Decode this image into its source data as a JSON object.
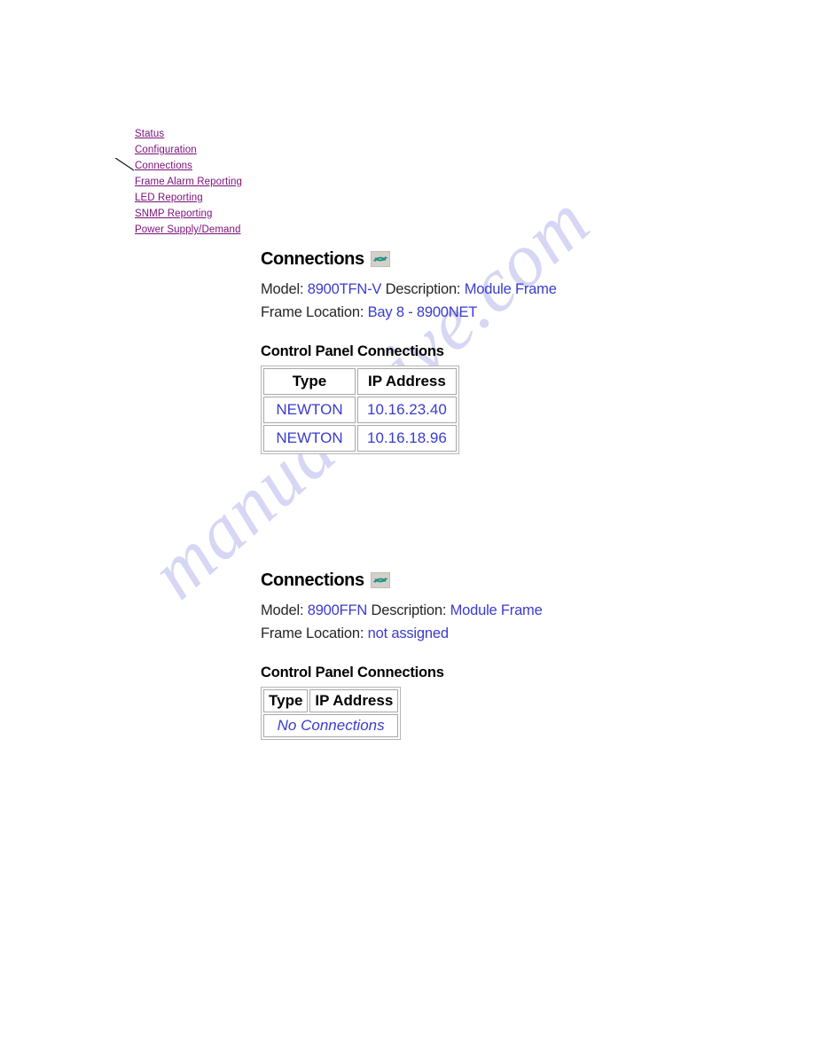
{
  "nav": {
    "items": [
      {
        "label": "Status"
      },
      {
        "label": "Configuration"
      },
      {
        "label": "Connections"
      },
      {
        "label": "Frame Alarm Reporting"
      },
      {
        "label": "LED Reporting"
      },
      {
        "label": "SNMP Reporting"
      },
      {
        "label": "Power Supply/Demand"
      }
    ]
  },
  "watermark": {
    "text": "manualshive.com"
  },
  "colors": {
    "link": "#7b0f7b",
    "value": "#3b3bcf",
    "label": "#262626",
    "refresh_icon": "#1d8e86",
    "watermark": "#d6d6f5"
  },
  "sections": [
    {
      "heading": "Connections",
      "refresh_icon": "refresh-icon",
      "model_label": "Model:",
      "model_value": "8900TFN-V",
      "description_label": "Description:",
      "description_value": "Module Frame",
      "frame_location_label": "Frame Location:",
      "frame_location_value": "Bay 8 - 8900NET",
      "table": {
        "title": "Control Panel Connections",
        "columns": [
          "Type",
          "IP Address"
        ],
        "rows": [
          [
            "NEWTON",
            "10.16.23.40"
          ],
          [
            "NEWTON",
            "10.16.18.96"
          ]
        ],
        "empty_message": ""
      }
    },
    {
      "heading": "Connections",
      "refresh_icon": "refresh-icon",
      "model_label": "Model:",
      "model_value": "8900FFN",
      "description_label": "Description:",
      "description_value": "Module Frame",
      "frame_location_label": "Frame Location:",
      "frame_location_value": "not assigned",
      "table": {
        "title": "Control Panel Connections",
        "columns": [
          "Type",
          "IP Address"
        ],
        "rows": [],
        "empty_message": "No Connections"
      }
    }
  ]
}
